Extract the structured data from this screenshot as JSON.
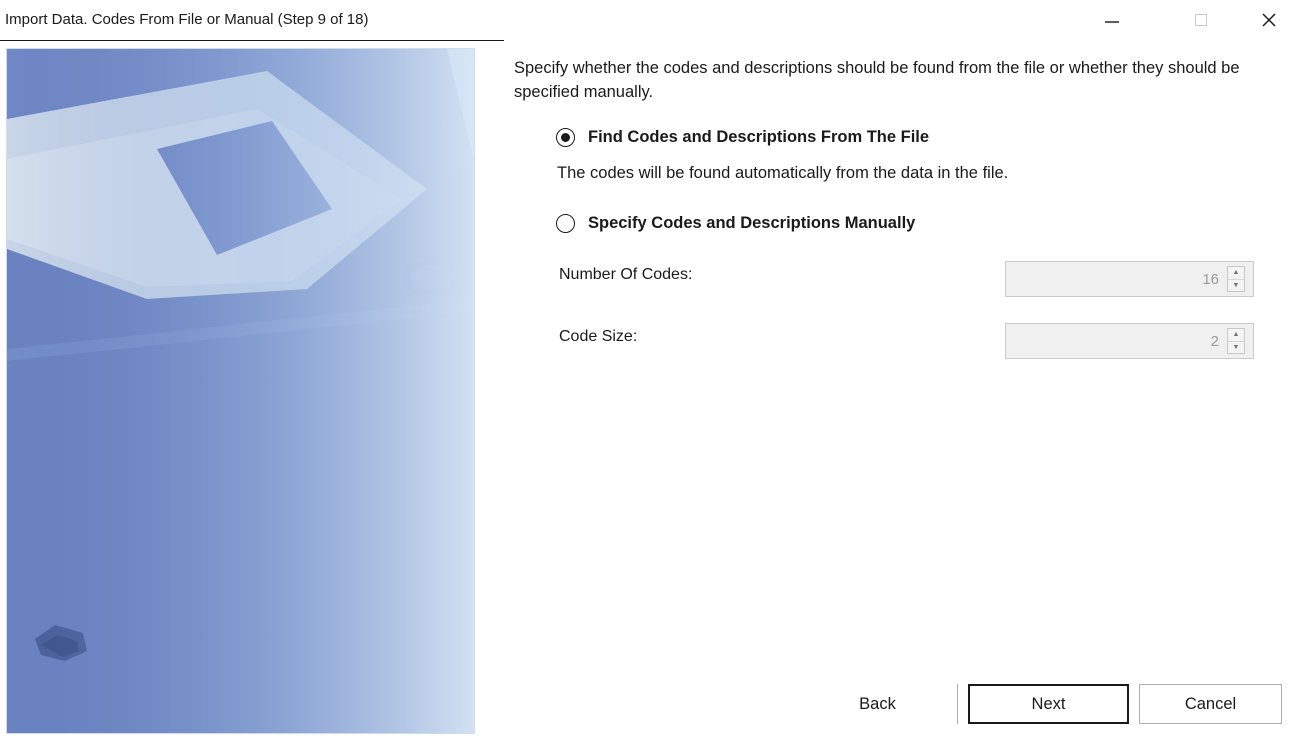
{
  "window": {
    "title": "Import Data.  Codes From File or Manual (Step 9 of 18)",
    "controls": {
      "minimize": "minimize-icon",
      "maximize": "maximize-icon",
      "close": "close-icon"
    }
  },
  "side_image": {
    "subject": "floppy-disk-icon"
  },
  "content": {
    "description": "Specify whether the codes and descriptions should be found from the file or whether they should be specified manually.",
    "options": [
      {
        "label": "Find Codes and Descriptions From The File",
        "selected": true
      },
      {
        "label": "Specify Codes and Descriptions Manually",
        "selected": false
      }
    ],
    "option_help": "The codes will be found automatically from the data in the file.",
    "fields": {
      "number_of_codes": {
        "label": "Number Of Codes:",
        "value": "16",
        "enabled": false
      },
      "code_size": {
        "label": "Code Size:",
        "value": "2",
        "enabled": false
      }
    }
  },
  "buttons": {
    "back": "Back",
    "next": "Next",
    "cancel": "Cancel"
  },
  "colors": {
    "image_blue": "#5d77b8",
    "image_fade": "#cfe0f4",
    "disabled_field": "#f0f0f0"
  }
}
